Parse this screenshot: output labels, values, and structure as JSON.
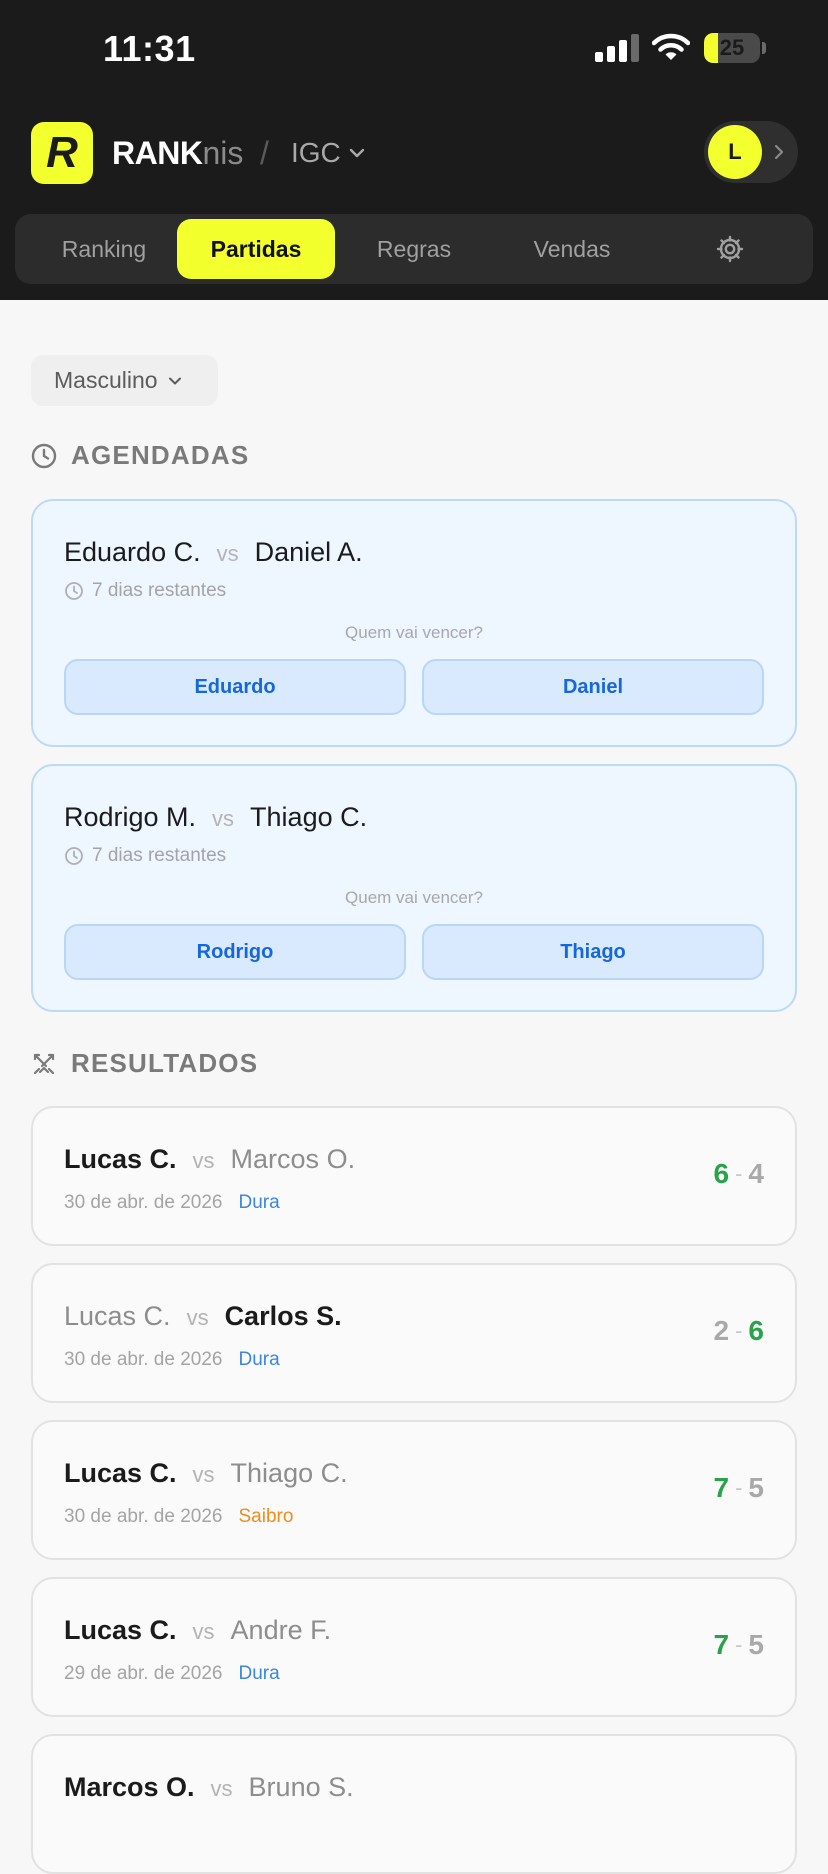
{
  "status_bar": {
    "time": "11:31",
    "battery": "25",
    "battery_level": 0.25
  },
  "header": {
    "brand_strong": "RANK",
    "brand_light": "nis",
    "separator": "/",
    "org": "IGC",
    "avatar_initial": "L"
  },
  "tabs": [
    {
      "label": "Ranking",
      "active": false
    },
    {
      "label": "Partidas",
      "active": true
    },
    {
      "label": "Regras",
      "active": false
    },
    {
      "label": "Vendas",
      "active": false
    }
  ],
  "filter": {
    "label": "Masculino"
  },
  "scheduled": {
    "title": "AGENDADAS",
    "vs": "vs",
    "prompt": "Quem vai vencer?",
    "matches": [
      {
        "player1": "Eduardo C.",
        "player2": "Daniel A.",
        "remaining": "7 dias restantes",
        "pick1": "Eduardo",
        "pick2": "Daniel"
      },
      {
        "player1": "Rodrigo M.",
        "player2": "Thiago C.",
        "remaining": "7 dias restantes",
        "pick1": "Rodrigo",
        "pick2": "Thiago"
      }
    ]
  },
  "results": {
    "title": "RESULTADOS",
    "vs": "vs",
    "matches": [
      {
        "player1": "Lucas C.",
        "player2": "Marcos O.",
        "winner": 1,
        "date": "30 de abr. de 2026",
        "surface": "Dura",
        "score1": "6",
        "score2": "4"
      },
      {
        "player1": "Lucas C.",
        "player2": "Carlos S.",
        "winner": 2,
        "date": "30 de abr. de 2026",
        "surface": "Dura",
        "score1": "2",
        "score2": "6"
      },
      {
        "player1": "Lucas C.",
        "player2": "Thiago C.",
        "winner": 1,
        "date": "30 de abr. de 2026",
        "surface": "Saibro",
        "score1": "7",
        "score2": "5"
      },
      {
        "player1": "Lucas C.",
        "player2": "Andre F.",
        "winner": 1,
        "date": "29 de abr. de 2026",
        "surface": "Dura",
        "score1": "7",
        "score2": "5"
      },
      {
        "player1": "Marcos O.",
        "player2": "Bruno S.",
        "winner": 1
      }
    ]
  },
  "colors": {
    "accent": "#f4ff2e",
    "header_bg": "#1b1b1b",
    "win_score": "#2aa24a",
    "surface_dura": "#3a86e0",
    "surface_saibro": "#ef8d1a"
  }
}
